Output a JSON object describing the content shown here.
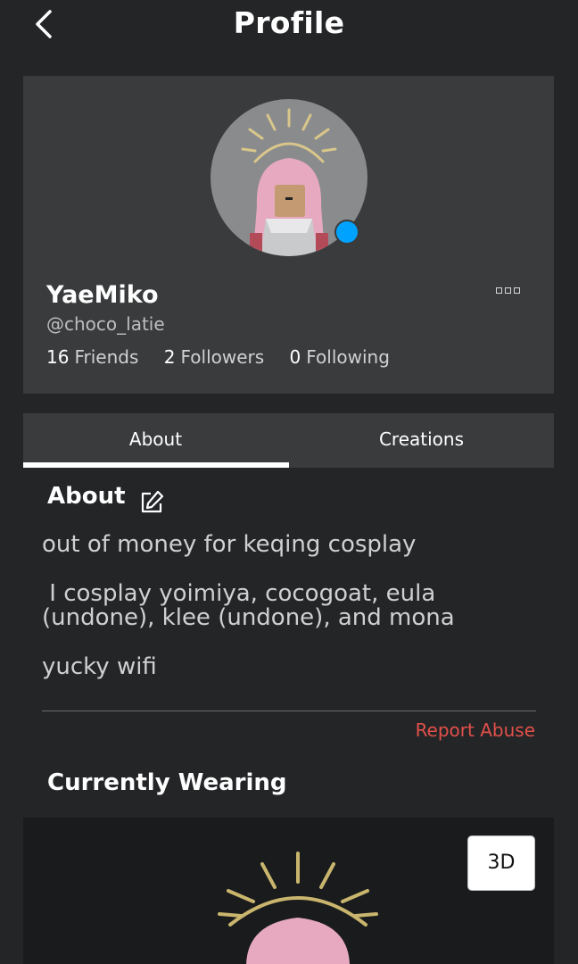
{
  "header": {
    "title": "Profile"
  },
  "profile": {
    "display_name": "YaeMiko",
    "username": "@choco_latie",
    "stats": [
      {
        "count": "16",
        "label": "Friends"
      },
      {
        "count": "2",
        "label": "Followers"
      },
      {
        "count": "0",
        "label": "Following"
      }
    ]
  },
  "tabs": [
    {
      "label": "About",
      "selected": true
    },
    {
      "label": "Creations",
      "selected": false
    }
  ],
  "about": {
    "title": "About",
    "lines": [
      "out of money for keqing cosplay",
      " I cosplay yoimiya, cocogoat, eula (undone), klee (undone), and mona",
      "yucky wifi"
    ],
    "report_label": "Report Abuse"
  },
  "wearing": {
    "title": "Currently Wearing",
    "view_3d_label": "3D"
  },
  "colors": {
    "background": "#232527",
    "card": "#393b3d",
    "online_dot": "#00a2ff",
    "report": "#e2504a"
  }
}
